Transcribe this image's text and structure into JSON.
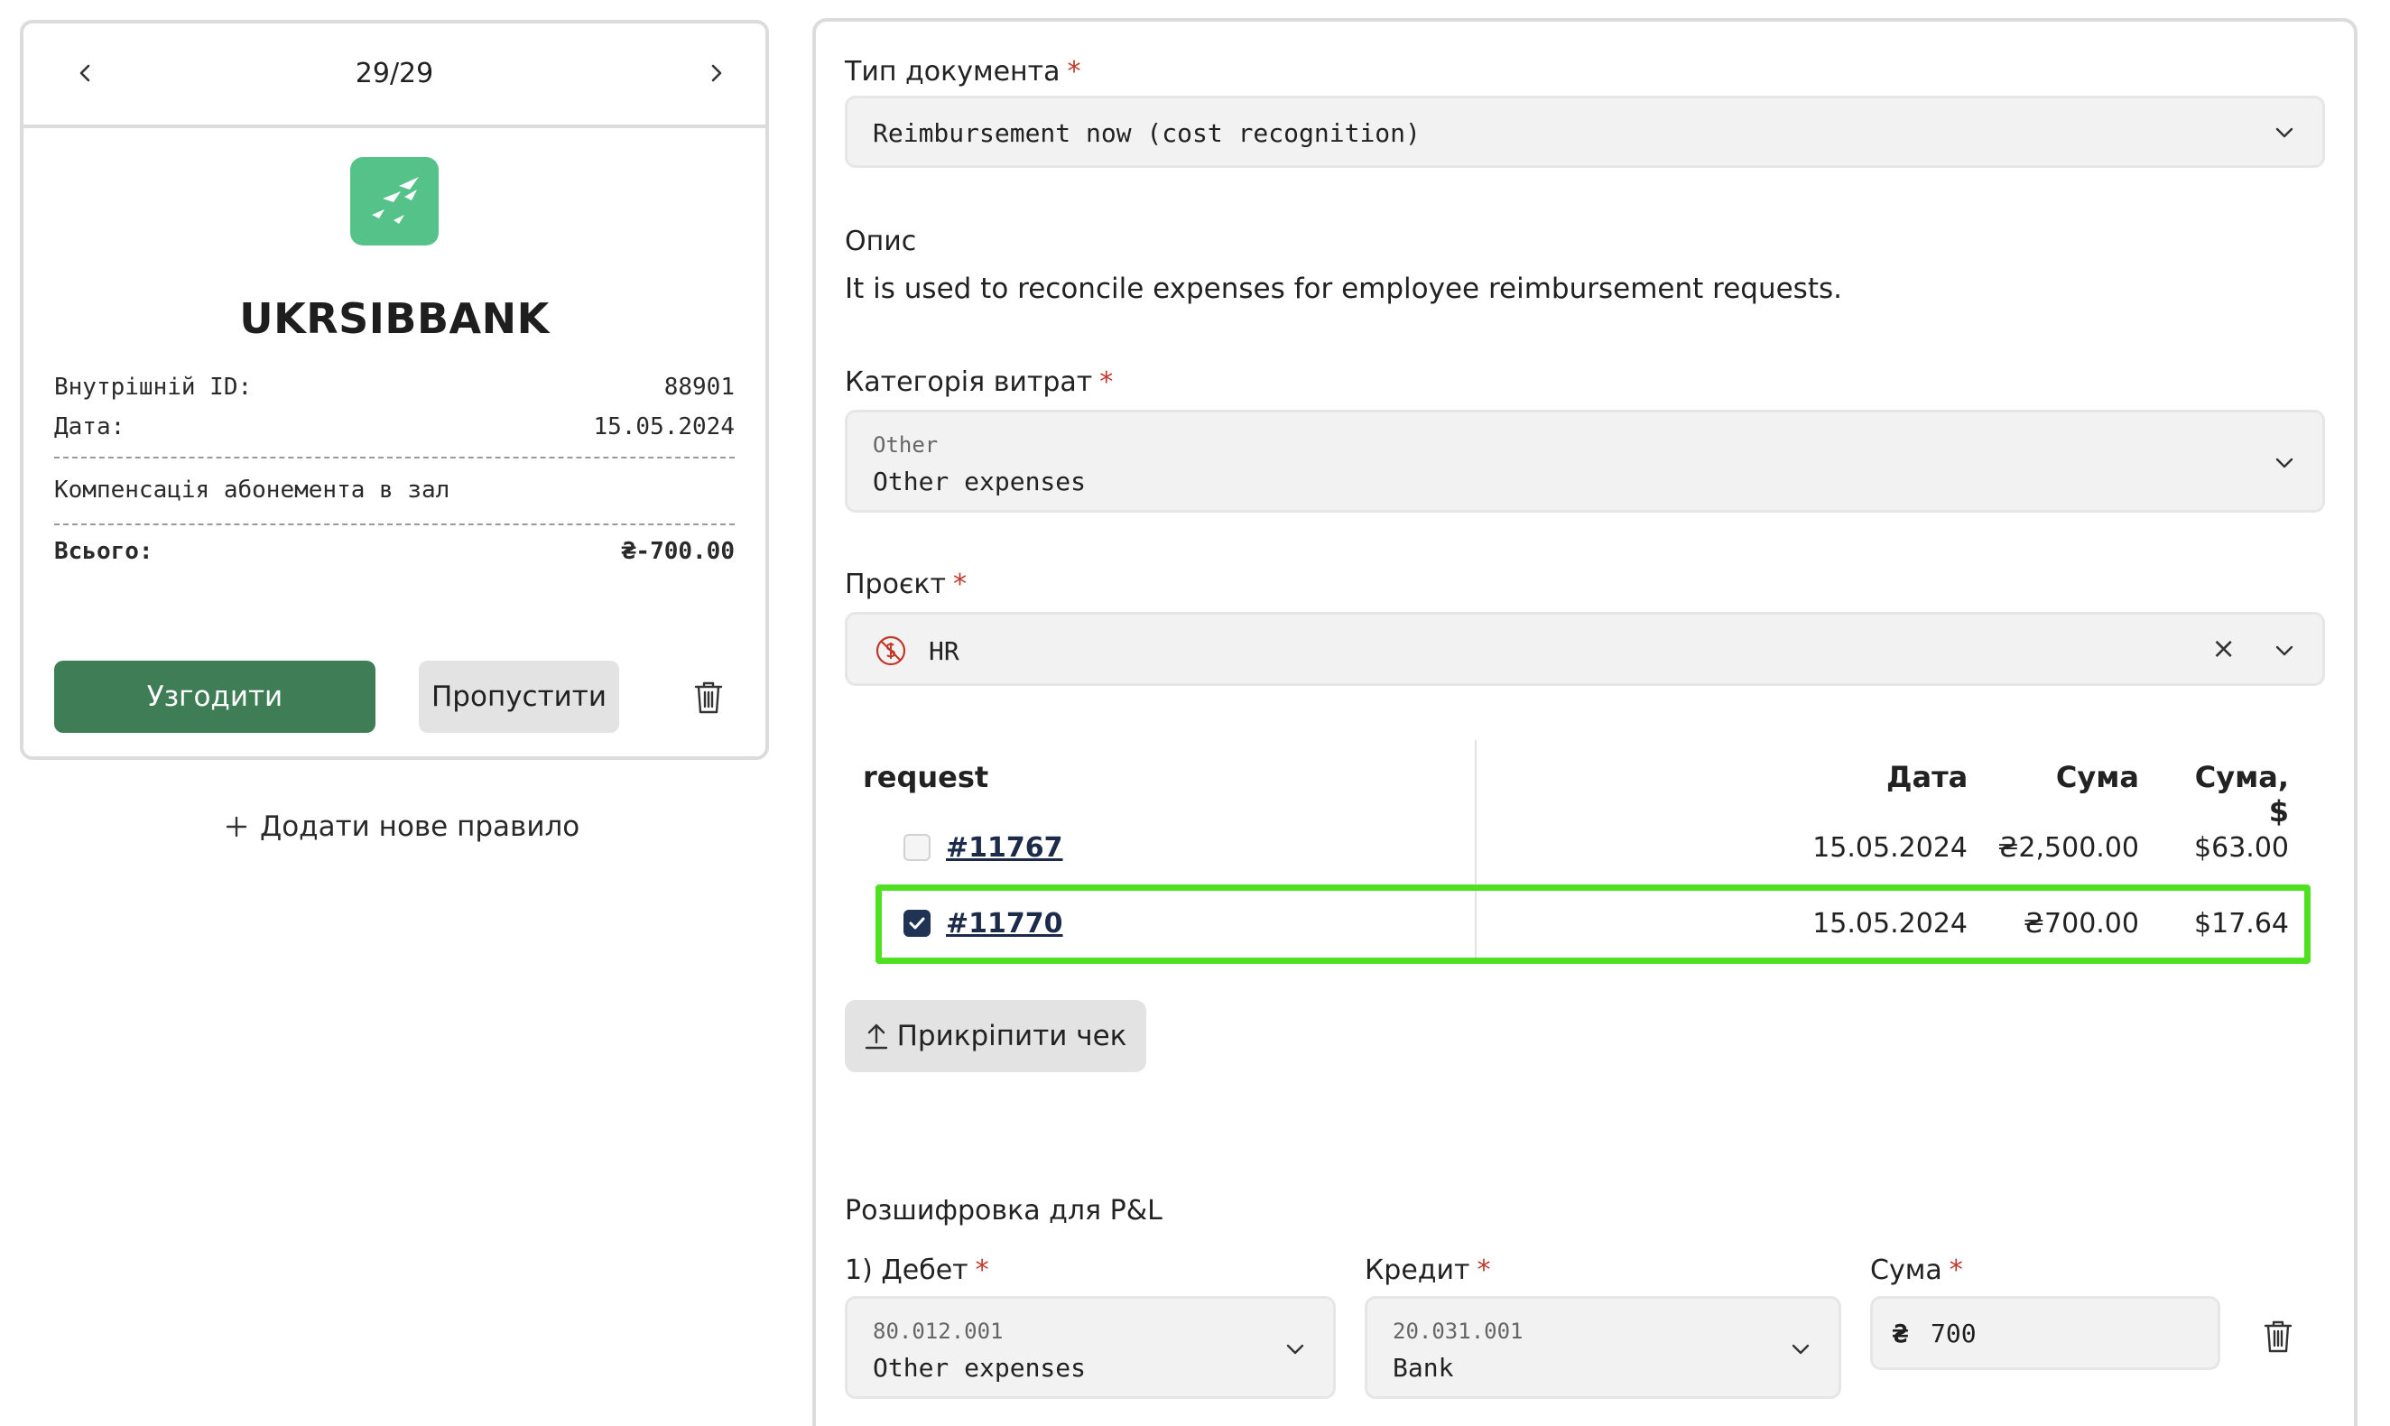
{
  "left": {
    "pager": {
      "count": "29/29"
    },
    "bank": {
      "name": "UKRSIBBANK",
      "logo_icon": "bank-birds-logo",
      "logo_color": "#55c28a"
    },
    "receipt": {
      "internal_id_label": "Внутрішній ID:",
      "internal_id_value": "88901",
      "date_label": "Дата:",
      "date_value": "15.05.2024",
      "description": "Компенсація абонемента в зал",
      "total_label": "Всього:",
      "total_value": "₴-700.00"
    },
    "actions": {
      "approve": "Узгодити",
      "skip": "Пропустити"
    },
    "add_rule": "Додати нове правило"
  },
  "right": {
    "doc_type": {
      "label": "Тип документа",
      "required": "*",
      "value": "Reimbursement now (cost recognition)"
    },
    "description": {
      "label": "Опис",
      "text": "It is used to reconcile expenses for employee reimbursement requests."
    },
    "category": {
      "label": "Категорія витрат",
      "required": "*",
      "code": "Other",
      "value": "Other expenses"
    },
    "project": {
      "label": "Проєкт",
      "required": "*",
      "value": "HR",
      "clear": "×"
    },
    "requests_table": {
      "columns": [
        "request",
        "Дата",
        "Сума",
        "Сума, $"
      ],
      "rows": [
        {
          "id": "#11767",
          "date": "15.05.2024",
          "amount": "₴2,500.00",
          "amount_usd": "$63.00",
          "checked": false
        },
        {
          "id": "#11770",
          "date": "15.05.2024",
          "amount": "₴700.00",
          "amount_usd": "$17.64",
          "checked": true
        }
      ]
    },
    "attach_button": "Прикріпити чек",
    "pnl": {
      "title": "Розшифровка для P&L",
      "debit": {
        "label": "1) Дебет",
        "required": "*",
        "code": "80.012.001",
        "value": "Other expenses"
      },
      "credit": {
        "label": "Кредит",
        "required": "*",
        "code": "20.031.001",
        "value": "Bank"
      },
      "amount": {
        "label": "Сума",
        "required": "*",
        "currency": "₴",
        "value": "700"
      }
    }
  },
  "colors": {
    "approve": "#3e7d55",
    "highlight": "#4fe021",
    "required": "#c0392b",
    "checkbox": "#1f3354"
  }
}
